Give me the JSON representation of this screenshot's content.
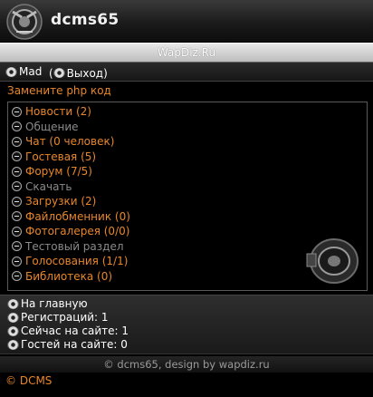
{
  "header": {
    "site_name": "dcms65"
  },
  "site_bar": {
    "title": "WapDiz.Ru"
  },
  "user_bar": {
    "username": "Mad",
    "logout_label": "Выход"
  },
  "notice": {
    "text": "Замените php код"
  },
  "menu": {
    "items": [
      {
        "label": "Новости (2)",
        "active": true
      },
      {
        "label": "Общение",
        "active": false
      },
      {
        "label": "Чат (0 человек)",
        "active": true
      },
      {
        "label": "Гостевая (5)",
        "active": true
      },
      {
        "label": "Форум (7/5)",
        "active": true
      },
      {
        "label": "Скачать",
        "active": false
      },
      {
        "label": "Загрузки (2)",
        "active": true
      },
      {
        "label": "Файлобменник (0)",
        "active": true
      },
      {
        "label": "Фотогалерея (0/0)",
        "active": true
      },
      {
        "label": "Тестовый раздел",
        "active": false
      },
      {
        "label": "Голосования (1/1)",
        "active": true
      },
      {
        "label": "Библиотека (0)",
        "active": true
      }
    ]
  },
  "info": {
    "home_label": "На главную",
    "registrations": "Регистраций: 1",
    "online_now": "Сейчас на сайте: 1",
    "guests": "Гостей на сайте: 0"
  },
  "footer": {
    "credit": "© dcms65, design by wapdiz.ru"
  },
  "copyright": {
    "symbol": "©",
    "link_text": "DCMS"
  },
  "colors": {
    "accent": "#e8862a",
    "dim": "#8a8a8a",
    "background": "#000000"
  }
}
